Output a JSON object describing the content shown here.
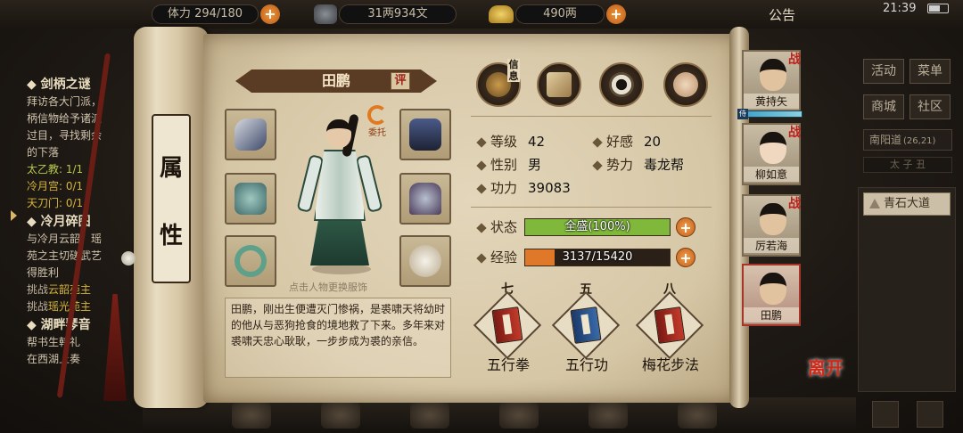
{
  "topbar": {
    "stamina": "294/180",
    "stamina_label": "体力",
    "copper": "31两934文",
    "gold": "490两",
    "announcement": "公告",
    "clock": "21:39"
  },
  "quest_log": {
    "quest1_title": "剑柄之谜",
    "quest1_lines": [
      "拜访各大门派，",
      "柄信物给予诸派",
      "过目，寻找剩余",
      "的下落"
    ],
    "quest1_progress": [
      {
        "name": "太乙教:",
        "value": "1/1"
      },
      {
        "name": "冷月宫:",
        "value": "0/1"
      },
      {
        "name": "天刀门:",
        "value": "0/1"
      }
    ],
    "quest2_title": "冷月碎图",
    "quest2_lines": [
      "与冷月云韶、瑶",
      "苑之主切磋武艺",
      "得胜利"
    ],
    "quest2_challenges": [
      {
        "prefix": "挑战",
        "name": "云韶苑主"
      },
      {
        "prefix": "挑战",
        "name": "瑶光苑主"
      }
    ],
    "quest3_title": "湖畔琴音",
    "quest3_lines": [
      "帮书生韩礼",
      "在西湖上奏"
    ]
  },
  "scroll": {
    "title_char1": "属",
    "title_char2": "性"
  },
  "character": {
    "name": "田鹏",
    "rate_label": "评",
    "entrust_label": "委托",
    "change_outfit_hint": "点击人物更换服饰",
    "bio": "田鹏，刚出生便遭灭门惨祸，是裘啸天将幼时的他从与恶狗抢食的境地救了下来。多年来对裘啸天忠心耿耿，一步步成为裘的亲信。"
  },
  "equipment": [
    {
      "slot": "bracer-slot",
      "icon": "bracer-icon"
    },
    {
      "slot": "belt-slot",
      "icon": "belt-icon"
    },
    {
      "slot": "chest-slot",
      "icon": "chest-icon"
    },
    {
      "slot": "armor-slot",
      "icon": "armor-icon"
    },
    {
      "slot": "ring-slot",
      "icon": "ring-icon"
    },
    {
      "slot": "pendant-slot",
      "icon": "pendant-icon"
    }
  ],
  "info_tabs": {
    "info_label": "信息",
    "icons": [
      "hat-icon",
      "map-icon",
      "bagua-icon",
      "meridian-icon"
    ]
  },
  "stats": {
    "level_label": "等级",
    "level": "42",
    "favor_label": "好感",
    "favor": "20",
    "gender_label": "性别",
    "gender": "男",
    "faction_label": "势力",
    "faction": "毒龙帮",
    "power_label": "功力",
    "power": "39083"
  },
  "status": {
    "label": "状态",
    "text": "全盛(100%)",
    "fraction": 1.0,
    "color": "#7fb83a"
  },
  "experience": {
    "label": "经验",
    "text": "3137/15420",
    "current": 3137,
    "max": 15420,
    "color": "#e0782a"
  },
  "skills": [
    {
      "level": "七",
      "name": "五行拳",
      "book": "red"
    },
    {
      "level": "五",
      "name": "五行功",
      "book": "blue"
    },
    {
      "level": "八",
      "name": "梅花步法",
      "book": "red"
    }
  ],
  "party": [
    {
      "name": "黄持矢",
      "battle": "战"
    },
    {
      "name": "柳如意",
      "battle": "战"
    },
    {
      "name": "厉若海",
      "battle": "战"
    },
    {
      "name": "田鹏",
      "battle": ""
    }
  ],
  "party_hp_tag": "侍",
  "right_menu": {
    "activity": "活动",
    "menu": "菜单",
    "shop": "商城",
    "community": "社区",
    "location": "南阳道",
    "coord": "(26,21)",
    "time": "太 子 丑",
    "road": "青石大道"
  },
  "leave_label": "离开",
  "colors": {
    "parchment": "#d9cba9",
    "accent_red": "#c0201a",
    "status_green": "#7fb83a",
    "exp_orange": "#e0782a"
  }
}
